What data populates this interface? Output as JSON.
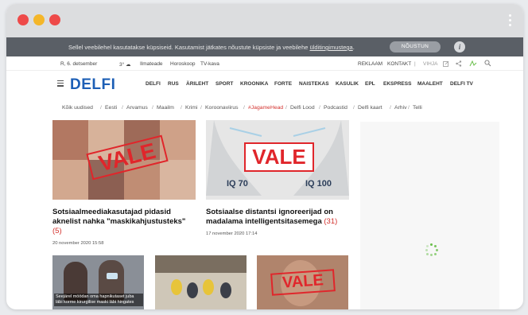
{
  "cookie": {
    "text": "Sellel veebilehel kasutatakse küpsiseid. Kasutamist jätkates nõustute küpsiste ja veebilehe ",
    "link": "ülditingimustega",
    "end": ".",
    "button": "NÕUSTUN",
    "info": "i"
  },
  "topbar": {
    "date": "R, 6. detsember",
    "weather": "3° ☁",
    "ilm": "Ilmateade",
    "horoskoop": "Horoskoop",
    "tv": "TV-kava",
    "reklaam": "REKLAAM",
    "kontakt": "KONTAKT",
    "sep": "|",
    "vihje": "VIHJA"
  },
  "logo": "DELFI",
  "nav": [
    "DELFI",
    "RUS",
    "ÄRILEHT",
    "SPORT",
    "KROONIKA",
    "FORTE",
    "NAISTEKAS",
    "KASULIK",
    "EPL",
    "EKSPRESS",
    "MAALEHT",
    "DELFI TV"
  ],
  "crumbs": [
    "Kõik uudised",
    "Eesti",
    "Arvamus",
    "Maailm",
    "Krimi",
    "Koroonaviirus",
    "#JagameHead",
    "Delfi Lood",
    "Podcastid",
    "Delfi kaart",
    "Arhiv",
    "Telli"
  ],
  "articles": [
    {
      "stamp": "VALE",
      "title": "Sotsiaalmeediakasutajad pidasid aknelist nahka \"maskikahjustusteks\"",
      "count": "(5)",
      "date": "20 november 2020 15:58"
    },
    {
      "stamp": "VALE",
      "iq_left": "IQ 70",
      "iq_right": "IQ 100",
      "title": "Sotsiaalse distantsi ignoreerijad on madalama intelligentsitasemega",
      "count": "(31)",
      "date": "17 november 2020 17:14"
    }
  ],
  "bottom": {
    "caption": "Seejärel möödan oma hapnikutaset juba läbi korme kirurgilise maski läbi hingates",
    "stamp": "VALE"
  },
  "colors": {
    "brand": "#1d5fb6",
    "stamp": "#e0262b",
    "accent": "#d3312d"
  }
}
